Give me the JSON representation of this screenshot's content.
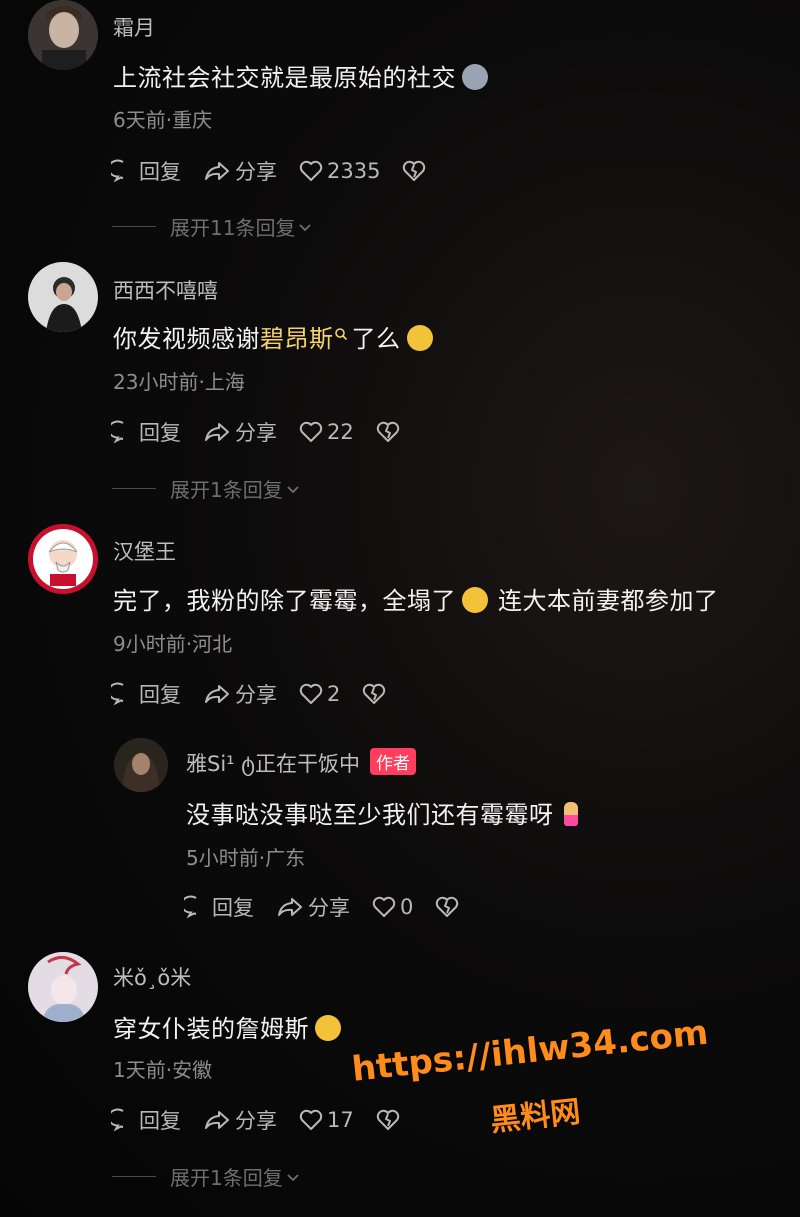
{
  "comments": [
    {
      "username": "霜月",
      "text": "上流社会社交就是最原始的社交",
      "meta": "6天前·重庆",
      "reply_label": "回复",
      "share_label": "分享",
      "likes": "2335",
      "expand_label": "展开11条回复"
    },
    {
      "username": "西西不嘻嘻",
      "text_before": "你发视频感谢",
      "text_highlight": "碧昂斯",
      "text_after": "了么",
      "meta": "23小时前·上海",
      "reply_label": "回复",
      "share_label": "分享",
      "likes": "22",
      "expand_label": "展开1条回复"
    },
    {
      "username": "汉堡王",
      "text_before": "完了，我粉的除了霉霉，全塌了",
      "text_after": "连大本前妻都参加了",
      "meta": "9小时前·河北",
      "reply_label": "回复",
      "share_label": "分享",
      "likes": "2"
    },
    {
      "username": "米ǒ¸ǒ米",
      "text": "穿女仆装的詹姆斯",
      "meta": "1天前·安徽",
      "reply_label": "回复",
      "share_label": "分享",
      "likes": "17",
      "expand_label": "展开1条回复"
    }
  ],
  "reply": {
    "username": "雅Si¹ ტ正在干饭中",
    "author_tag": "作者",
    "text": "没事哒没事哒至少我们还有霉霉呀",
    "meta": "5小时前·广东",
    "reply_label": "回复",
    "share_label": "分享",
    "likes": "0"
  },
  "watermark": {
    "url": "https://ihlw34.com",
    "name": "黑料网"
  },
  "colors": {
    "highlight": "#f5d36a",
    "author_tag": "#ff3d5c",
    "watermark": "#ff8c1a"
  }
}
